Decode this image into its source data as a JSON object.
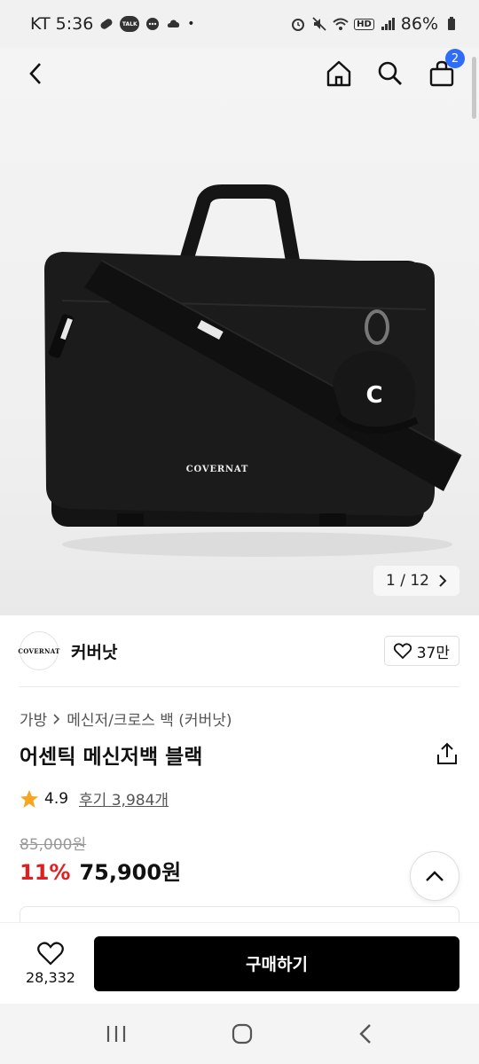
{
  "status_bar": {
    "carrier_time": "KT 5:36",
    "battery": "86%",
    "talk_badge": "TALK"
  },
  "nav": {
    "cart_count": "2"
  },
  "hero": {
    "brand_on_bag": "COVERNAT",
    "cap_letter": "C",
    "pager": "1 / 12"
  },
  "seller": {
    "logo_text": "COVERNAT",
    "name": "커버낫",
    "likes": "37만"
  },
  "product": {
    "breadcrumb_1": "가방",
    "breadcrumb_2": "메신저/크로스 백 (커버낫)",
    "title": "어센틱 메신저백 블랙",
    "rating": "4.9",
    "reviews": "후기 3,984개",
    "original_price": "85,000원",
    "discount": "11%",
    "price": "75,900원"
  },
  "purchase_bar": {
    "wish_count": "28,332",
    "buy_label": "구매하기"
  },
  "colors": {
    "accent_blue": "#2f6df6",
    "discount_red": "#e02020",
    "star": "#f5a623",
    "buy_button": "#000000"
  }
}
